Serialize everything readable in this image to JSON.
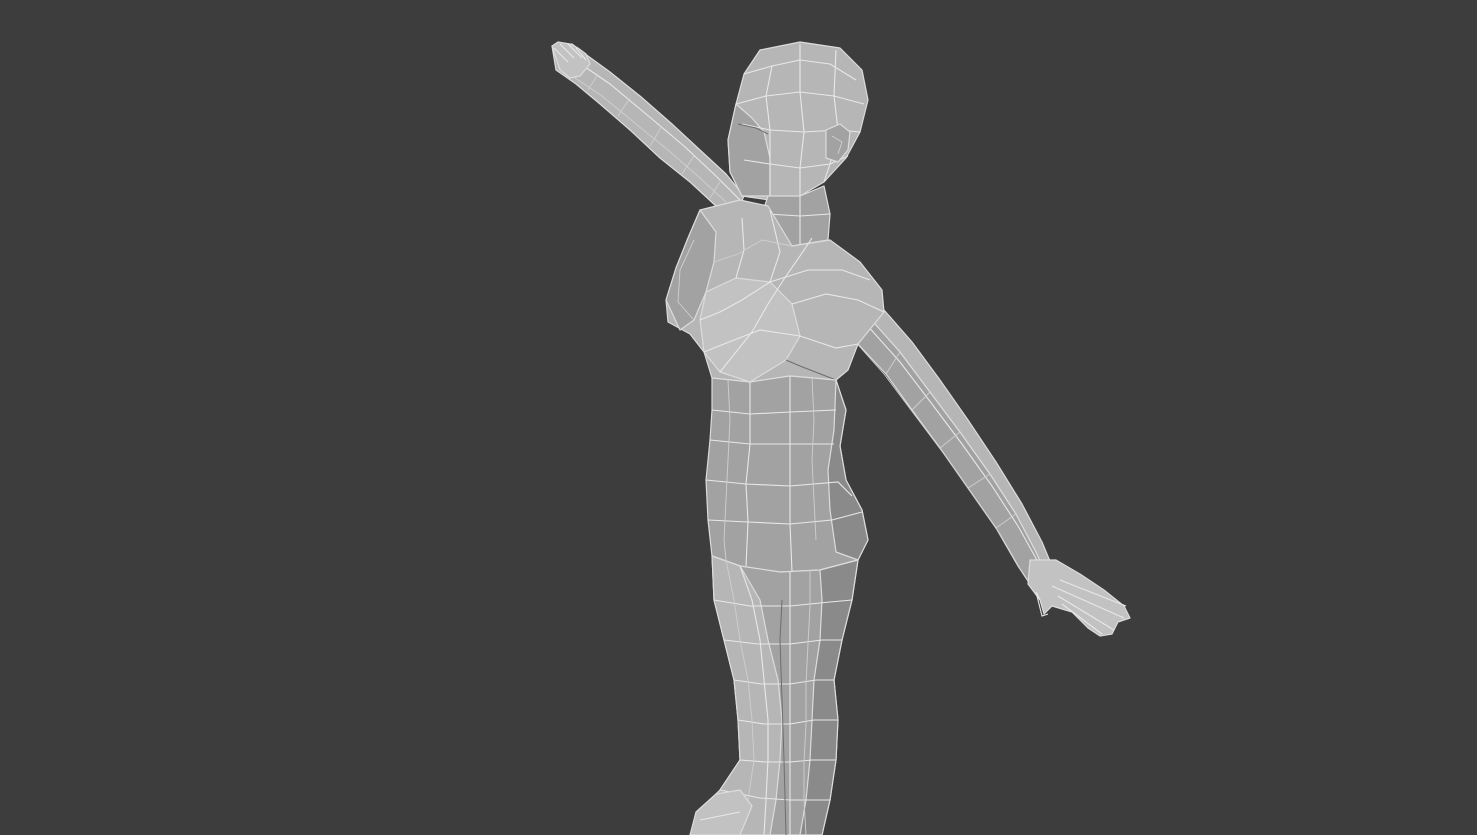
{
  "viewport": {
    "background_color": "#3d3d3d",
    "mesh_color": "#a8a8a8",
    "wire_color": "#e8e8e8"
  }
}
